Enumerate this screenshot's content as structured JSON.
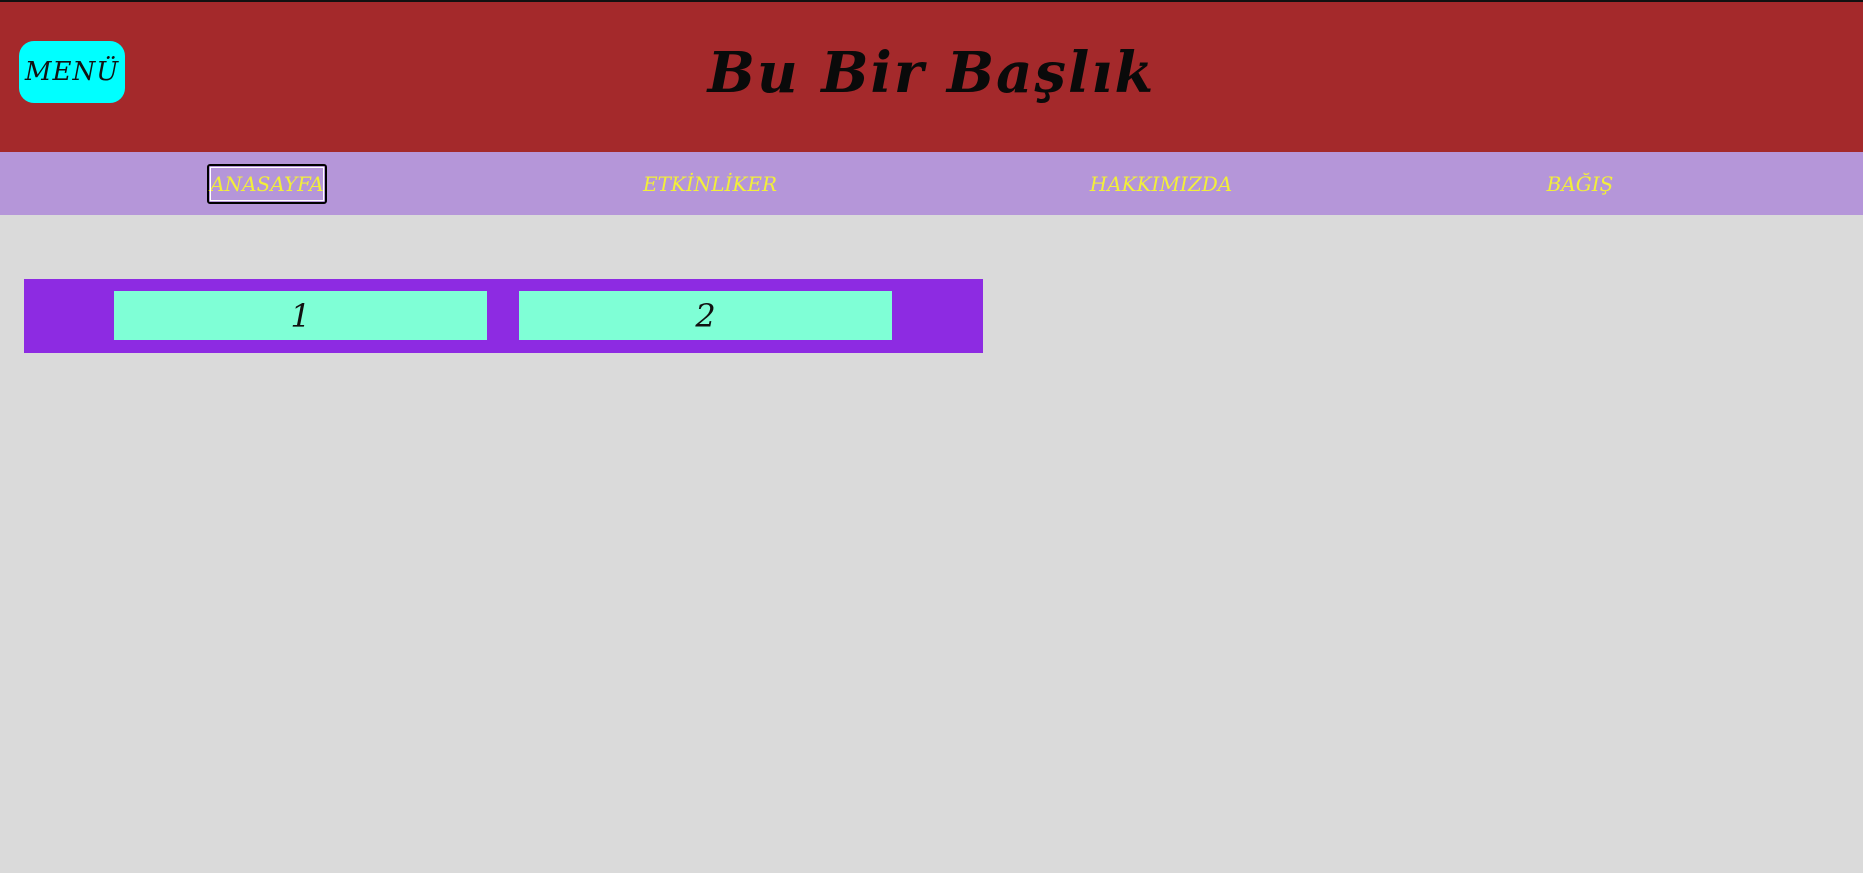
{
  "header": {
    "menu_label": "MENÜ",
    "title": "Bu Bir Başlık",
    "background": "#a4292b"
  },
  "nav": {
    "background": "#b596d9",
    "text_color": "#f2ef3a",
    "items": [
      {
        "label": "ANASAYFA",
        "active": true
      },
      {
        "label": "ETKİNLİKER",
        "active": false
      },
      {
        "label": "HAKKIMIZDA",
        "active": false
      },
      {
        "label": "BAĞIŞ",
        "active": false
      }
    ]
  },
  "content": {
    "background": "#dadada",
    "bar_color": "#8d2be2",
    "box_color": "#7fffd6",
    "boxes": [
      {
        "label": "1"
      },
      {
        "label": "2"
      }
    ]
  }
}
